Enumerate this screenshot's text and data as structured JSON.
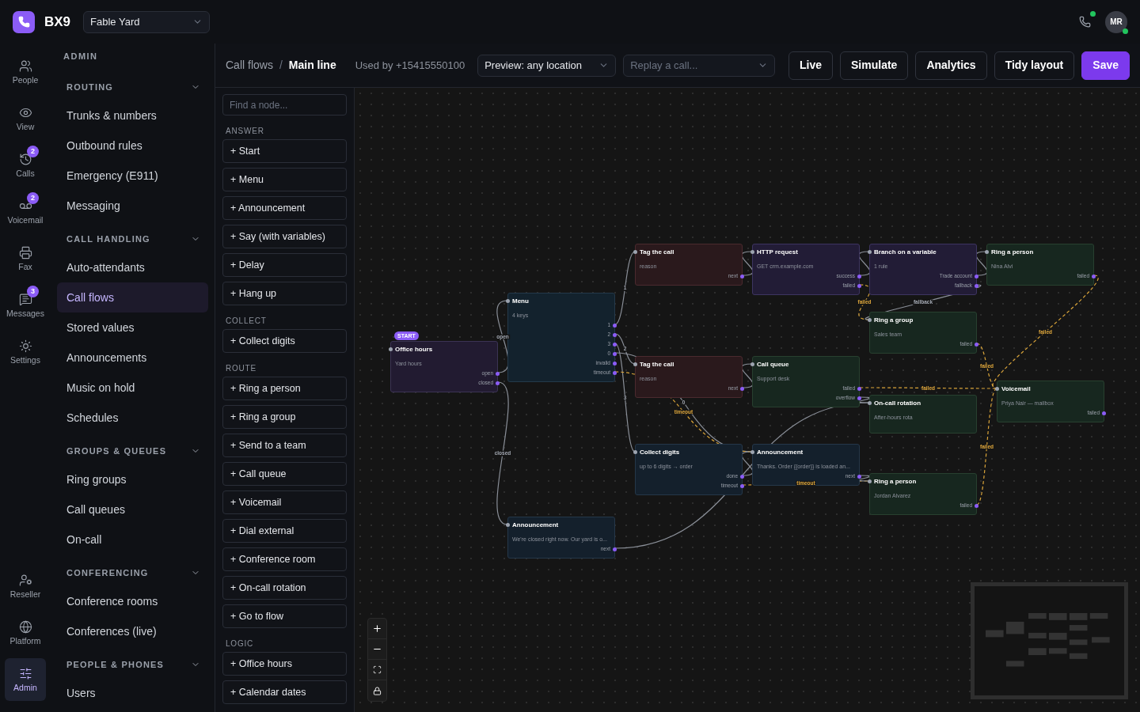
{
  "brand": {
    "name": "BX9",
    "workspace": "Fable Yard"
  },
  "user": {
    "initials": "MR",
    "online": true
  },
  "rail": {
    "top": [
      {
        "kind": "people",
        "label": "People",
        "selected": false
      },
      {
        "kind": "view",
        "label": "View",
        "selected": false
      },
      {
        "kind": "calls",
        "label": "Calls",
        "badge": "2",
        "selected": false
      },
      {
        "kind": "voicemail",
        "label": "Voicemail",
        "badge": "2",
        "selected": false
      },
      {
        "kind": "fax",
        "label": "Fax",
        "selected": false
      },
      {
        "kind": "messages",
        "label": "Messages",
        "badge": "3",
        "selected": false
      },
      {
        "kind": "settings",
        "label": "Settings",
        "selected": false
      }
    ],
    "bottom": [
      {
        "kind": "reseller",
        "label": "Reseller",
        "selected": false
      },
      {
        "kind": "platform",
        "label": "Platform",
        "selected": false
      },
      {
        "kind": "admin",
        "label": "Admin",
        "selected": true
      }
    ]
  },
  "nav": {
    "heading": "ADMIN",
    "sections": [
      {
        "title": "ROUTING",
        "expanded": true,
        "items": [
          {
            "label": "Trunks & numbers",
            "selected": false
          },
          {
            "label": "Outbound rules",
            "selected": false
          },
          {
            "label": "Emergency (E911)",
            "selected": false
          },
          {
            "label": "Messaging",
            "selected": false
          }
        ]
      },
      {
        "title": "CALL HANDLING",
        "expanded": true,
        "items": [
          {
            "label": "Auto-attendants",
            "selected": false
          },
          {
            "label": "Call flows",
            "selected": true
          },
          {
            "label": "Stored values",
            "selected": false
          },
          {
            "label": "Announcements",
            "selected": false
          },
          {
            "label": "Music on hold",
            "selected": false
          },
          {
            "label": "Schedules",
            "selected": false
          }
        ]
      },
      {
        "title": "GROUPS & QUEUES",
        "expanded": true,
        "items": [
          {
            "label": "Ring groups",
            "selected": false
          },
          {
            "label": "Call queues",
            "selected": false
          },
          {
            "label": "On-call",
            "selected": false
          }
        ]
      },
      {
        "title": "CONFERENCING",
        "expanded": true,
        "items": [
          {
            "label": "Conference rooms",
            "selected": false
          },
          {
            "label": "Conferences (live)",
            "selected": false
          }
        ]
      },
      {
        "title": "PEOPLE & PHONES",
        "expanded": true,
        "items": [
          {
            "label": "Users",
            "selected": false
          }
        ]
      }
    ]
  },
  "header": {
    "breadcrumb": [
      "Call flows",
      "Main line"
    ],
    "separator": "/",
    "used_by": "Used by +15415550100",
    "preview": {
      "value": "Preview: any location"
    },
    "replay": {
      "placeholder": "Replay a call..."
    },
    "buttons": [
      {
        "label": "Live",
        "kind": "default"
      },
      {
        "label": "Simulate",
        "kind": "default"
      },
      {
        "label": "Analytics",
        "kind": "default"
      },
      {
        "label": "Tidy layout",
        "kind": "default"
      },
      {
        "label": "Save",
        "kind": "primary"
      }
    ]
  },
  "palette": {
    "search": {
      "placeholder": "Find a node..."
    },
    "groups": [
      {
        "title": "ANSWER",
        "items": [
          "+ Start",
          "+ Menu",
          "+ Announcement",
          "+ Say (with variables)",
          "+ Delay",
          "+ Hang up"
        ]
      },
      {
        "title": "COLLECT",
        "items": [
          "+ Collect digits"
        ]
      },
      {
        "title": "ROUTE",
        "items": [
          "+ Ring a person",
          "+ Ring a group",
          "+ Send to a team",
          "+ Call queue",
          "+ Voicemail",
          "+ Dial external",
          "+ Conference room",
          "+ On-call rotation",
          "+ Go to flow"
        ]
      },
      {
        "title": "LOGIC",
        "items": [
          "+ Office hours",
          "+ Calendar dates"
        ]
      }
    ]
  },
  "flow": {
    "nodes": [
      {
        "kind": "trigger",
        "title": "Office hours",
        "subtitle": "Yard hours",
        "start": true,
        "badge": "START",
        "ports": [
          "open",
          "closed"
        ]
      },
      {
        "kind": "menu",
        "title": "Menu",
        "subtitle": "4 keys",
        "start": false,
        "ports": [
          "1",
          "2",
          "3",
          "0",
          "invalid",
          "timeout"
        ]
      },
      {
        "kind": "tag",
        "title": "Tag the call",
        "subtitle": "reason",
        "start": false,
        "ports": [
          "next"
        ]
      },
      {
        "kind": "logic",
        "title": "HTTP request",
        "subtitle": "GET crm.example.com",
        "start": false,
        "ports": [
          "success",
          "failed"
        ]
      },
      {
        "kind": "logic",
        "title": "Branch on a variable",
        "subtitle": "1 rule",
        "start": false,
        "ports": [
          "Trade account",
          "fallback"
        ]
      },
      {
        "kind": "route",
        "title": "Ring a person",
        "subtitle": "Nina Alvi",
        "start": false,
        "ports": [
          "failed"
        ]
      },
      {
        "kind": "route",
        "title": "Ring a group",
        "subtitle": "Sales team",
        "start": false,
        "ports": [
          "failed"
        ]
      },
      {
        "kind": "tag",
        "title": "Tag the call",
        "subtitle": "reason",
        "start": false,
        "ports": [
          "next"
        ]
      },
      {
        "kind": "route",
        "title": "Call queue",
        "subtitle": "Support desk",
        "start": false,
        "ports": [
          "failed",
          "overflow"
        ]
      },
      {
        "kind": "route",
        "title": "Voicemail",
        "subtitle": "Priya Nair — mailbox",
        "start": false,
        "ports": [
          "failed"
        ]
      },
      {
        "kind": "route",
        "title": "On-call rotation",
        "subtitle": "After-hours rota",
        "start": false
      },
      {
        "kind": "collect",
        "title": "Collect digits",
        "subtitle": "up to 6 digits → order",
        "start": false,
        "ports": [
          "done",
          "timeout"
        ]
      },
      {
        "kind": "collect",
        "title": "Announcement",
        "subtitle": "Thanks. Order {{order}} is loaded an...",
        "start": false,
        "ports": [
          "next"
        ]
      },
      {
        "kind": "route",
        "title": "Ring a person",
        "subtitle": "Jordan Alvarez",
        "start": false,
        "ports": [
          "failed"
        ]
      },
      {
        "kind": "collect",
        "title": "Announcement",
        "subtitle": "We're closed right now. Our yard is o...",
        "start": false,
        "ports": [
          "next"
        ]
      }
    ],
    "edges": [
      {
        "kind": "normal",
        "label": "open"
      },
      {
        "kind": "normal",
        "label": "closed"
      },
      {
        "kind": "normal",
        "label": "1"
      },
      {
        "kind": "normal",
        "label": "2"
      },
      {
        "kind": "normal",
        "label": "3"
      },
      {
        "kind": "normal",
        "label": "0"
      },
      {
        "kind": "failure",
        "label": "timeout"
      },
      {
        "kind": "normal"
      },
      {
        "kind": "normal"
      },
      {
        "kind": "failure",
        "label": "failed"
      },
      {
        "kind": "normal"
      },
      {
        "kind": "normal",
        "label": "fallback"
      },
      {
        "kind": "failure",
        "label": "failed"
      },
      {
        "kind": "failure",
        "label": "failed"
      },
      {
        "kind": "normal"
      },
      {
        "kind": "failure",
        "label": "failed"
      },
      {
        "kind": "normal"
      },
      {
        "kind": "normal"
      },
      {
        "kind": "failure",
        "label": "timeout"
      },
      {
        "kind": "normal"
      },
      {
        "kind": "failure",
        "label": "failed"
      },
      {
        "kind": "normal"
      }
    ]
  }
}
